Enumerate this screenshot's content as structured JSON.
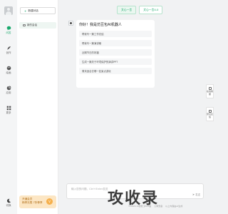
{
  "rail": {
    "items": [
      {
        "label": "问答",
        "icon": "chat-bubble-icon",
        "active": true
      },
      {
        "label": "创作",
        "icon": "feather-icon",
        "active": false
      },
      {
        "label": "绘画",
        "icon": "palette-icon",
        "active": false
      },
      {
        "label": "应用",
        "icon": "grid-apps-icon",
        "active": false
      },
      {
        "label": "更多",
        "icon": "more-apps-icon",
        "active": false
      }
    ],
    "theme_label": "切换",
    "accent_color": "#19a86c"
  },
  "sidebar": {
    "new_chat_label": "新建对话",
    "sessions": [
      {
        "label": "新的会话"
      }
    ],
    "promo": {
      "line1": "开通会员",
      "line2": "畅享无限 7折尊享",
      "coin": "V"
    }
  },
  "tabs": [
    {
      "label": "文心一言",
      "active": true
    },
    {
      "label": "文心一言4.0",
      "active": false
    }
  ],
  "chat": {
    "greeting": "你好！我是仿豆包AI机器人",
    "suggestions": [
      "帮我写一篇工作总结",
      "帮我写一篇演讲稿",
      "近期节日的祝福",
      "生成一篇关于环境保护的演讲PPT",
      "周末适合去哪一处景点游玩"
    ]
  },
  "float_buttons": [
    {
      "label": "在线客服",
      "icon": "headset-icon"
    },
    {
      "label": "意见反馈",
      "icon": "feedback-icon"
    }
  ],
  "input": {
    "placeholder": "输入您的问题，Ctrl+Enter发送",
    "send_label": "发送"
  },
  "footer": {
    "items": [
      "©2024 AI智能 沪ICP备",
      "公网安备",
      "以上内容由AI生成"
    ]
  },
  "watermark": "攻收录"
}
